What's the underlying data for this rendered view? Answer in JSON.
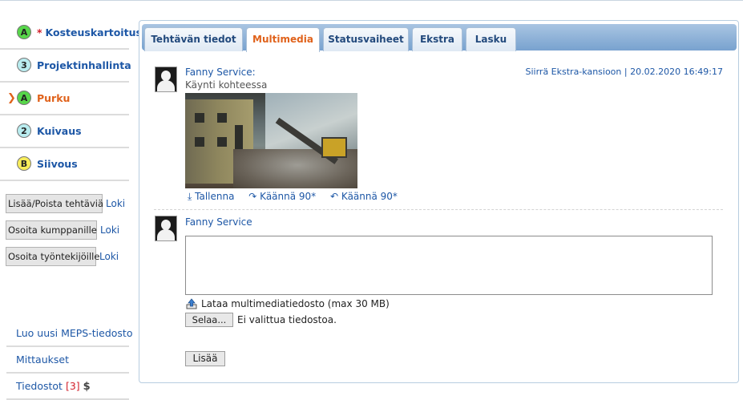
{
  "sidebar": {
    "tasks": [
      {
        "badge": "A",
        "badge_color": "#57d64a",
        "prefix": "*",
        "label": "Kosteuskartoitus",
        "active": false
      },
      {
        "badge": "3",
        "badge_color": "#b9ecef",
        "prefix": "",
        "label": "Projektinhallinta",
        "active": false
      },
      {
        "badge": "A",
        "badge_color": "#57d64a",
        "prefix": "",
        "label": "Purku",
        "active": true
      },
      {
        "badge": "2",
        "badge_color": "#b9ecef",
        "prefix": "",
        "label": "Kuivaus",
        "active": false
      },
      {
        "badge": "B",
        "badge_color": "#f7ec5a",
        "prefix": "",
        "label": "Siivous",
        "active": false
      }
    ],
    "actions": [
      {
        "button": "Lisää/Poista tehtäviä",
        "link": "Loki"
      },
      {
        "button": "Osoita kumppanille",
        "link": "Loki"
      },
      {
        "button": "Osoita työntekijöille",
        "link": "Loki"
      }
    ],
    "bottom_links": {
      "new_meps": "Luo uusi MEPS-tiedosto",
      "measurements": "Mittaukset",
      "files_label": "Tiedostot",
      "files_count": "[3]",
      "files_icon": "$"
    }
  },
  "tabs": [
    {
      "label": "Tehtävän tiedot",
      "active": false
    },
    {
      "label": "Multimedia",
      "active": true
    },
    {
      "label": "Statusvaiheet",
      "active": false
    },
    {
      "label": "Ekstra",
      "active": false
    },
    {
      "label": "Lasku",
      "active": false
    }
  ],
  "post": {
    "author": "Fanny Service:",
    "text": "Käynti kohteessa",
    "move_link": "Siirrä Ekstra-kansioon",
    "separator": "|",
    "timestamp": "20.02.2020 16:49:17",
    "image_alt": "demolition-photo",
    "actions": {
      "save": "Tallenna",
      "rotate_right": "Käännä 90*",
      "rotate_left": "Käännä 90*",
      "save_icon": "⤓",
      "rotate_right_icon": "↷",
      "rotate_left_icon": "↶"
    }
  },
  "reply": {
    "author": "Fanny Service",
    "comment_value": "",
    "upload_label": "Lataa multimediatiedosto (max 30 MB)",
    "browse_button": "Selaa...",
    "no_file": "Ei valittua tiedostoa.",
    "submit_button": "Lisää"
  },
  "colors": {
    "link": "#1d57a6",
    "active_orange": "#e0621b",
    "star_red": "#d21f2a"
  }
}
